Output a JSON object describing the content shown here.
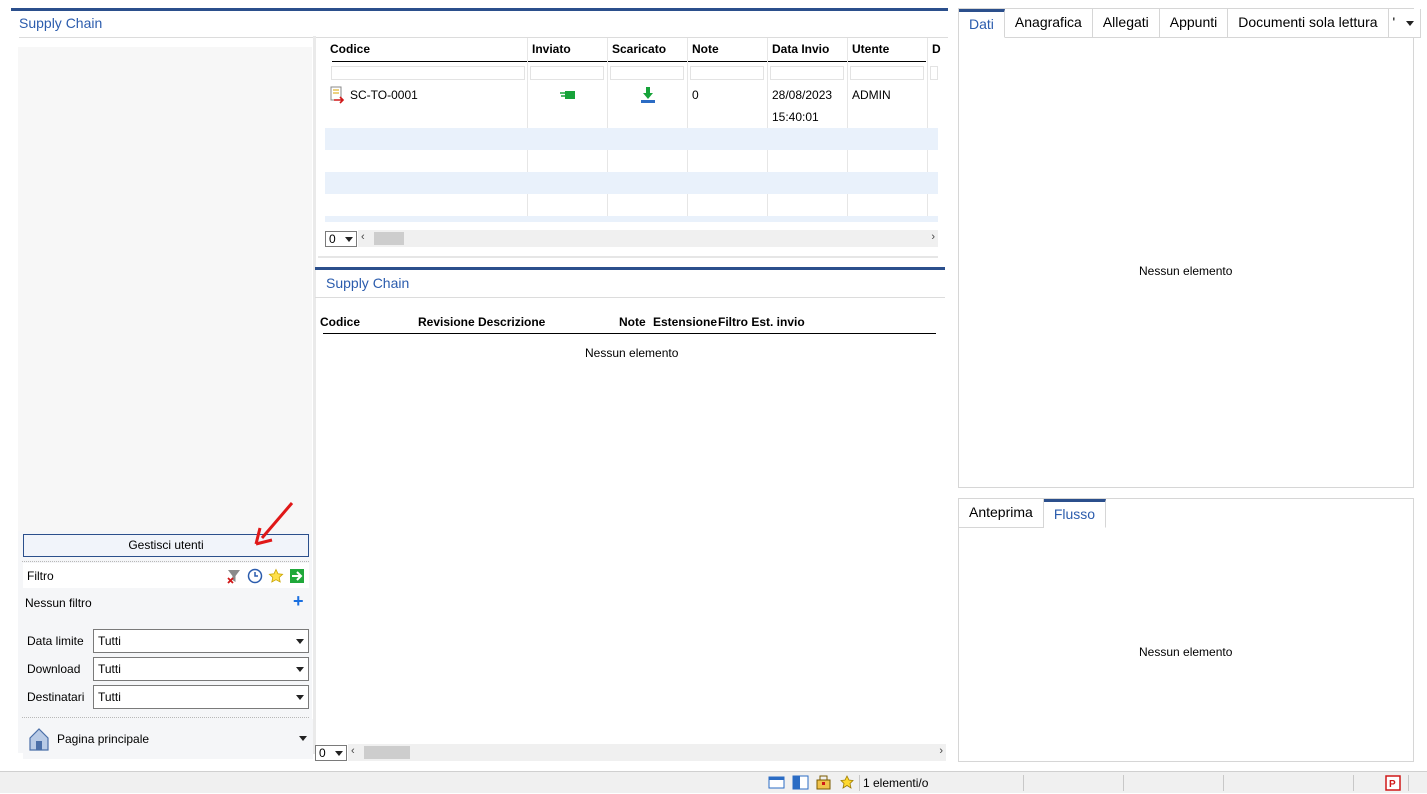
{
  "main": {
    "title": "Supply Chain",
    "manage_users_label": "Gestisci utenti",
    "filter": {
      "label": "Filtro",
      "no_filter": "Nessun filtro",
      "icons": [
        "filter-clear-icon",
        "history-icon",
        "favorite-star-icon",
        "apply-arrow-icon"
      ],
      "fields": [
        {
          "label": "Data limite",
          "value": "Tutti"
        },
        {
          "label": "Download",
          "value": "Tutti"
        },
        {
          "label": "Destinatari",
          "value": "Tutti"
        }
      ]
    },
    "nav_home_label": "Pagina principale"
  },
  "grid": {
    "columns": [
      "Codice",
      "Inviato",
      "Scaricato",
      "Note",
      "Data Invio",
      "Utente",
      "D"
    ],
    "rows": [
      {
        "codice": "SC-TO-0001",
        "inviato_icon": "sent-icon",
        "scaricato_icon": "download-icon",
        "note": "0",
        "data_invio_date": "28/08/2023",
        "data_invio_time": "15:40:01",
        "utente": "ADMIN"
      }
    ],
    "pager_value": "0"
  },
  "sub": {
    "title": "Supply Chain",
    "columns": [
      "Codice",
      "Revisione",
      "Descrizione",
      "Note",
      "Estensione",
      "Filtro Est. invio"
    ],
    "empty_text": "Nessun elemento",
    "pager_value": "0"
  },
  "right_top": {
    "tabs": [
      "Dati",
      "Anagrafica",
      "Allegati",
      "Appunti",
      "Documenti sola lettura"
    ],
    "active_tab": "Dati",
    "empty_text": "Nessun elemento"
  },
  "right_bottom": {
    "tabs": [
      "Anteprima",
      "Flusso"
    ],
    "active_tab": "Flusso",
    "empty_text": "Nessun elemento"
  },
  "status": {
    "count_text": "1 elementi/o"
  },
  "colors": {
    "accent": "#2b4f8c",
    "title_blue": "#2b5cad",
    "row_stripe": "#e9f1fb"
  }
}
